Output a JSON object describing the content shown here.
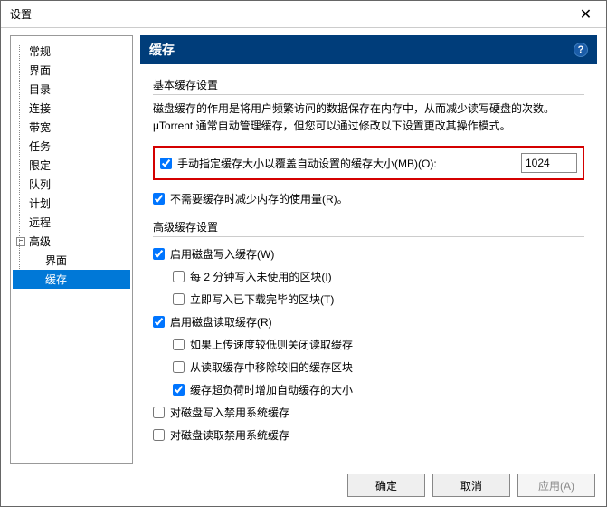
{
  "window": {
    "title": "设置"
  },
  "tree": {
    "items": [
      "常规",
      "界面",
      "目录",
      "连接",
      "带宽",
      "任务",
      "限定",
      "队列",
      "计划",
      "远程",
      "高级"
    ],
    "sub": [
      "界面",
      "缓存"
    ]
  },
  "header": {
    "title": "缓存",
    "help": "?"
  },
  "basic": {
    "group_title": "基本缓存设置",
    "desc": "磁盘缓存的作用是将用户频繁访问的数据保存在内存中，从而减少读写硬盘的次数。μTorrent 通常自动管理缓存，但您可以通过修改以下设置更改其操作模式。",
    "manual_label": "手动指定缓存大小以覆盖自动设置的缓存大小(MB)(O):",
    "manual_value": "1024",
    "reduce_label": "不需要缓存时减少内存的使用量(R)。"
  },
  "adv": {
    "group_title": "高级缓存设置",
    "write_enable": "启用磁盘写入缓存(W)",
    "write_unused": "每 2 分钟写入未使用的区块(I)",
    "write_finished": "立即写入已下载完毕的区块(T)",
    "read_enable": "启用磁盘读取缓存(R)",
    "read_slow": "如果上传速度较低则关闭读取缓存",
    "read_old": "从读取缓存中移除较旧的缓存区块",
    "read_thrash": "缓存超负荷时增加自动缓存的大小",
    "sys_write": "对磁盘写入禁用系统缓存",
    "sys_read": "对磁盘读取禁用系统缓存"
  },
  "footer": {
    "ok": "确定",
    "cancel": "取消",
    "apply": "应用(A)"
  }
}
